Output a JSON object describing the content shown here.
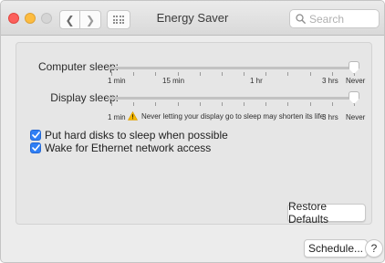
{
  "window": {
    "title": "Energy Saver",
    "traffic_lights": [
      "close",
      "minimize",
      "zoom-disabled"
    ]
  },
  "toolbar": {
    "back_icon": "chevron-left-icon",
    "back_glyph": "❮",
    "forward_icon": "chevron-right-icon",
    "forward_glyph": "❯",
    "grid_icon": "show-all-grid-icon"
  },
  "search": {
    "placeholder": "Search",
    "value": ""
  },
  "computer_sleep": {
    "label": "Computer sleep:",
    "value": "Never",
    "ticks": {
      "min": "1 min",
      "fifteen": "15 min",
      "hour": "1 hr",
      "three": "3 hrs",
      "never": "Never"
    }
  },
  "display_sleep": {
    "label": "Display sleep:",
    "value": "Never",
    "ticks": {
      "min": "1 min",
      "three": "3 hrs",
      "never": "Never"
    },
    "warning": "Never letting your display go to sleep may shorten its life"
  },
  "options": [
    {
      "label": "Put hard disks to sleep when possible",
      "checked": true
    },
    {
      "label": "Wake for Ethernet network access",
      "checked": true
    }
  ],
  "buttons": {
    "restore": "Restore Defaults",
    "schedule": "Schedule...",
    "help": "?"
  },
  "colors": {
    "accent": "#2f7ff5",
    "close": "#fc605c",
    "minimize": "#fdbc40",
    "warning": "#f5b800"
  }
}
